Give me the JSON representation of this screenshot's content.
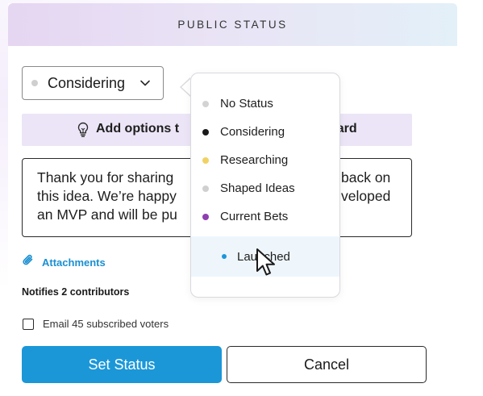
{
  "header": {
    "title": "PUBLIC STATUS"
  },
  "status_select": {
    "value": "Considering",
    "dot_color": "#cfcfcf",
    "icon": "chevron-down-icon"
  },
  "info_bar": {
    "text_visible": "Add options t",
    "text_tail": "oard",
    "icon": "lightbulb-icon"
  },
  "comment": {
    "lines": [
      "Thank you for sharing",
      "this idea. We’re happy",
      "an MVP and will be pu"
    ],
    "tails": [
      "back on",
      "veloped",
      ""
    ]
  },
  "attachments": {
    "label": "Attachments",
    "icon": "paperclip-icon",
    "color": "#1a8fd1"
  },
  "notifies": {
    "label": "Notifies 2 contributors"
  },
  "email": {
    "label": "Email 45 subscribed voters",
    "checked": false
  },
  "buttons": {
    "primary": "Set Status",
    "secondary": "Cancel",
    "primary_color": "#1b97d8"
  },
  "dropdown": {
    "items": [
      {
        "label": "No Status",
        "color": "#d3d3d3"
      },
      {
        "label": "Considering",
        "color": "#1a1a1a"
      },
      {
        "label": "Researching",
        "color": "#f0d264"
      },
      {
        "label": "Shaped Ideas",
        "color": "#d0d0d0"
      },
      {
        "label": "Current Bets",
        "color": "#8e3fb0"
      },
      {
        "label": "Launched",
        "color": "#1b97d8",
        "highlighted": true
      }
    ]
  }
}
